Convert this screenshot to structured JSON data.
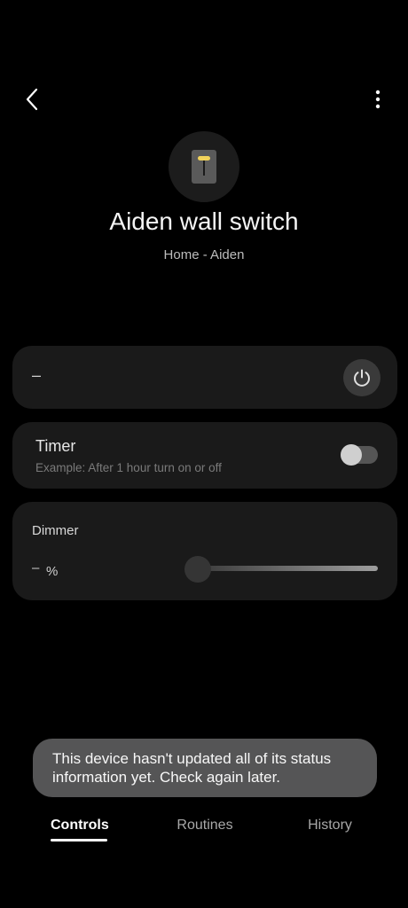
{
  "header": {
    "back_icon": "chevron-left-icon",
    "more_icon": "more-vertical-icon"
  },
  "device": {
    "icon": "wall-switch-icon",
    "name": "Aiden wall switch",
    "location": "Home - Aiden"
  },
  "power_card": {
    "value": "–",
    "power_icon": "power-icon"
  },
  "timer_card": {
    "title": "Timer",
    "subtitle": "Example: After 1 hour turn on or off",
    "enabled": false
  },
  "dimmer_card": {
    "title": "Dimmer",
    "value": "–",
    "unit": "%",
    "level": 0
  },
  "toast": {
    "message": "This device hasn't updated all of its status information yet. Check again later."
  },
  "tabs": {
    "items": [
      {
        "label": "Controls",
        "selected": true
      },
      {
        "label": "Routines",
        "selected": false
      },
      {
        "label": "History",
        "selected": false
      }
    ]
  },
  "colors": {
    "background": "#000000",
    "card": "#1a1a1a",
    "switch_accent": "#f2d35b"
  }
}
